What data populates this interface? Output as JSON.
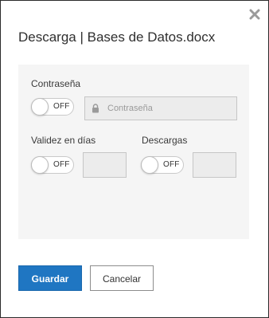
{
  "dialog": {
    "title": "Descarga | Bases de Datos.docx",
    "close_icon": "close-icon"
  },
  "password": {
    "label": "Contraseña",
    "toggle_state": "OFF",
    "placeholder": "Contraseña",
    "value": "",
    "lock_icon": "lock-icon"
  },
  "validity": {
    "label": "Validez en días",
    "toggle_state": "OFF",
    "value": ""
  },
  "downloads": {
    "label": "Descargas",
    "toggle_state": "OFF",
    "value": ""
  },
  "actions": {
    "save_label": "Guardar",
    "cancel_label": "Cancelar"
  },
  "colors": {
    "primary": "#1f76c2",
    "panel_bg": "#f5f5f5"
  }
}
